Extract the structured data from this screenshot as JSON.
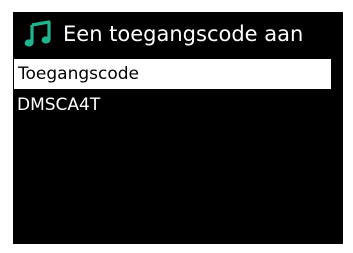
{
  "header": {
    "title": "Een toegangscode aan",
    "icon": "music-note-icon",
    "icon_color": "#1fb58f"
  },
  "menu": {
    "items": [
      {
        "label": "Toegangscode",
        "selected": true
      },
      {
        "label": "DMSCA4T",
        "selected": false
      }
    ]
  },
  "colors": {
    "background": "#000000",
    "selected_bg": "#ffffff",
    "text": "#ffffff",
    "selected_text": "#000000"
  }
}
